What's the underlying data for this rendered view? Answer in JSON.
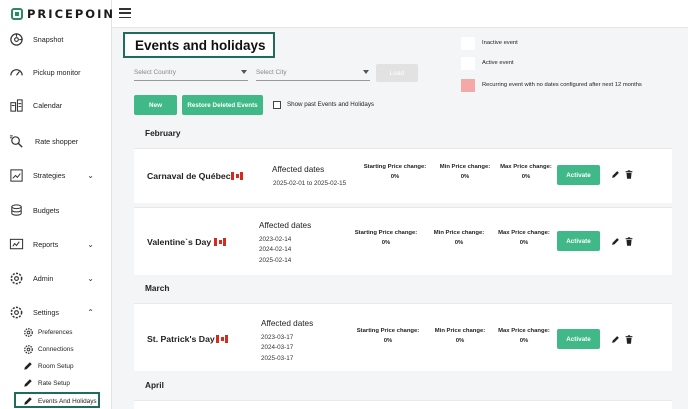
{
  "brand": {
    "name": "PRICEPOINT"
  },
  "colors": {
    "accent": "#40b888",
    "highlight_border": "#1f6b5f",
    "recurring_swatch": "#f4a9a8",
    "inactive_swatch": "#ffffff",
    "active_swatch": "#ffffff"
  },
  "sidebar": {
    "items": [
      {
        "label": "Snapshot",
        "icon": "snapshot-icon"
      },
      {
        "label": "Pickup monitor",
        "icon": "gauge-icon"
      },
      {
        "label": "Calendar",
        "icon": "calendar-icon"
      },
      {
        "label": "Rate shopper",
        "icon": "rate-shopper-icon"
      },
      {
        "label": "Strategies",
        "icon": "strategies-icon"
      },
      {
        "label": "Budgets",
        "icon": "budgets-icon"
      },
      {
        "label": "Reports",
        "icon": "reports-icon"
      },
      {
        "label": "Admin",
        "icon": "admin-gear-icon"
      },
      {
        "label": "Settings",
        "icon": "settings-gear-icon"
      }
    ],
    "settings_subitems": [
      {
        "label": "Preferences",
        "icon": "gear-icon"
      },
      {
        "label": "Connections",
        "icon": "gear-icon"
      },
      {
        "label": "Room Setup",
        "icon": "pencil-icon"
      },
      {
        "label": "Rate Setup",
        "icon": "pencil-icon"
      },
      {
        "label": "Events And Holidays",
        "icon": "pencil-icon"
      }
    ]
  },
  "page": {
    "title": "Events and holidays"
  },
  "filters": {
    "country_placeholder": "Select Country",
    "city_placeholder": "Select City",
    "load_label": "Load"
  },
  "legend": {
    "inactive": "Inactive event",
    "active": "Active event",
    "recurring": "Recurring event with no dates configured after next 12 months"
  },
  "actions": {
    "new_label": "New",
    "restore_label": "Restore Deleted Events",
    "show_past_label": "Show past Events and Holidays",
    "show_past_checked": false
  },
  "labels": {
    "affected_dates": "Affected dates",
    "starting_price_change": "Starting Price change:",
    "min_price_change": "Min Price change:",
    "max_price_change": "Max Price change:",
    "activate": "Activate"
  },
  "months": [
    {
      "name": "February",
      "events": [
        {
          "name": "Carnaval de Québec",
          "country_flag": "canada-flag",
          "dates": [
            "2025-02-01 to 2025-02-15"
          ],
          "starting": "0%",
          "min": "0%",
          "max": "0%"
        },
        {
          "name": "Valentine`s Day",
          "country_flag": "canada-flag",
          "dates": [
            "2023-02-14",
            "2024-02-14",
            "2025-02-14"
          ],
          "starting": "0%",
          "min": "0%",
          "max": "0%"
        }
      ]
    },
    {
      "name": "March",
      "events": [
        {
          "name": "St. Patrick's Day",
          "country_flag": "canada-flag",
          "dates": [
            "2023-03-17",
            "2024-03-17",
            "2025-03-17"
          ],
          "starting": "0%",
          "min": "0%",
          "max": "0%"
        }
      ]
    },
    {
      "name": "April",
      "events": []
    }
  ]
}
